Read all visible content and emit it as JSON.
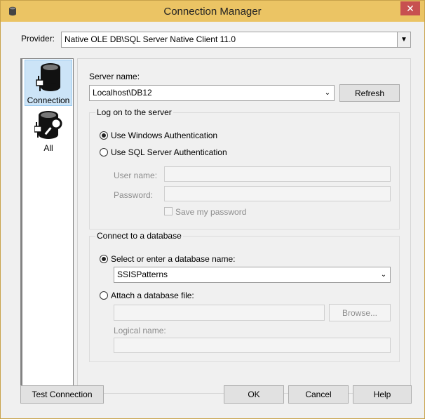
{
  "window": {
    "title": "Connection Manager",
    "close_glyph": "✕",
    "accent_color": "#ebc464"
  },
  "provider": {
    "label": "Provider:",
    "value": "Native OLE DB\\SQL Server Native Client 11.0"
  },
  "nav": {
    "items": [
      {
        "label": "Connection",
        "icon": "database-plug-icon",
        "selected": true
      },
      {
        "label": "All",
        "icon": "database-wrench-icon",
        "selected": false
      }
    ]
  },
  "server": {
    "label": "Server name:",
    "value": "Localhost\\DB12",
    "refresh_label": "Refresh"
  },
  "logon": {
    "group_title": "Log on to the server",
    "windows_auth_label": "Use Windows Authentication",
    "sql_auth_label": "Use SQL Server Authentication",
    "selected": "windows",
    "user_name_label": "User name:",
    "user_name_value": "",
    "password_label": "Password:",
    "password_value": "",
    "save_password_label": "Save my password"
  },
  "database": {
    "group_title": "Connect to a database",
    "select_label": "Select or enter a database name:",
    "selected_db": "SSISPatterns",
    "attach_label": "Attach a database file:",
    "attach_value": "",
    "browse_label": "Browse...",
    "logical_name_label": "Logical name:",
    "logical_name_value": ""
  },
  "buttons": {
    "test_connection": "Test Connection",
    "ok": "OK",
    "cancel": "Cancel",
    "help": "Help"
  }
}
